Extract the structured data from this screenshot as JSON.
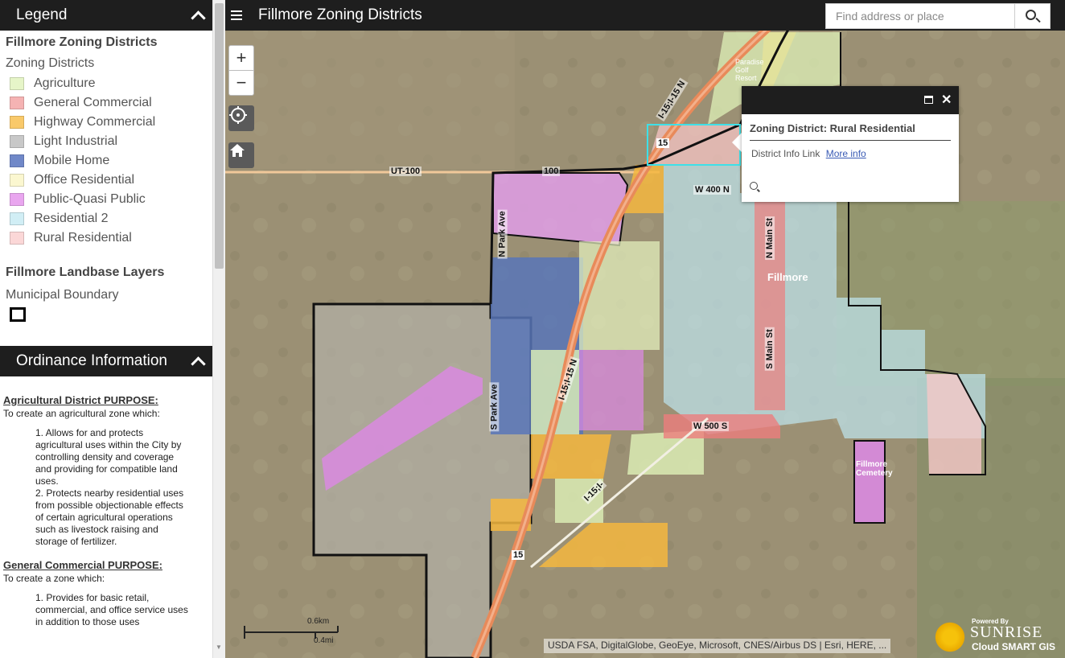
{
  "legend": {
    "header": "Legend",
    "layer_title": "Fillmore Zoning Districts",
    "subtitle": "Zoning Districts",
    "items": [
      {
        "label": "Agriculture",
        "color": "#e6f5c8"
      },
      {
        "label": "General Commercial",
        "color": "#f5b3b3"
      },
      {
        "label": "Highway Commercial",
        "color": "#f9c96a"
      },
      {
        "label": "Light Industrial",
        "color": "#c8c8c8"
      },
      {
        "label": "Mobile Home",
        "color": "#7088c8"
      },
      {
        "label": "Office Residential",
        "color": "#fbf7d0"
      },
      {
        "label": "Public-Quasi Public",
        "color": "#e9a6ef"
      },
      {
        "label": "Residential 2",
        "color": "#d1eef5"
      },
      {
        "label": "Rural Residential",
        "color": "#fbd7d7"
      }
    ],
    "landbase_title": "Fillmore Landbase Layers",
    "boundary_label": "Municipal Boundary"
  },
  "ordinance": {
    "header": "Ordinance Information",
    "sections": [
      {
        "heading": "Agricultural District PURPOSE:",
        "intro": "To create an agricultural zone which:",
        "points": [
          "1. Allows for and protects agricultural uses within the City by controlling density and coverage and providing for compatible land uses.",
          "2. Protects nearby residential uses from possible objectionable effects of certain agricultural operations such as livestock raising and storage of fertilizer."
        ]
      },
      {
        "heading": "General Commercial PURPOSE:",
        "intro": "To create a zone which:",
        "points": [
          "1. Provides for basic retail, commercial, and office service uses in addition to those uses"
        ]
      }
    ]
  },
  "app": {
    "title": "Fillmore Zoning Districts",
    "search_placeholder": "Find address or place"
  },
  "map": {
    "zoom_in": "+",
    "zoom_out": "−",
    "labels": {
      "ut100": "UT-100",
      "hwy100": "100",
      "w400n": "W 400 N",
      "w500s": "W 500 S",
      "fillmore": "Fillmore",
      "n_main": "N Main St",
      "s_main": "S Main St",
      "i15_north": "I-15;I-15 N",
      "i15_mid": "I-15;I-15 N",
      "i15_south": "I-15;I-",
      "s_park": "S Park Ave",
      "n_park": "N Park Ave",
      "cemetery": "Fillmore Cemetery",
      "golf": "Paradise Golf Resort",
      "shield_15": "15"
    },
    "scale_km": "0.6km",
    "scale_mi": "0.4mi",
    "attribution": "USDA FSA, DigitalGlobe, GeoEye, Microsoft, CNES/Airbus DS | Esri, HERE, ...",
    "powered_by": "Powered By",
    "brand": "SUNRISE",
    "brand_sub": "Cloud SMART GIS"
  },
  "popup": {
    "title": "Zoning District: Rural Residential",
    "link_label": "District Info Link",
    "link_text": "More info"
  }
}
